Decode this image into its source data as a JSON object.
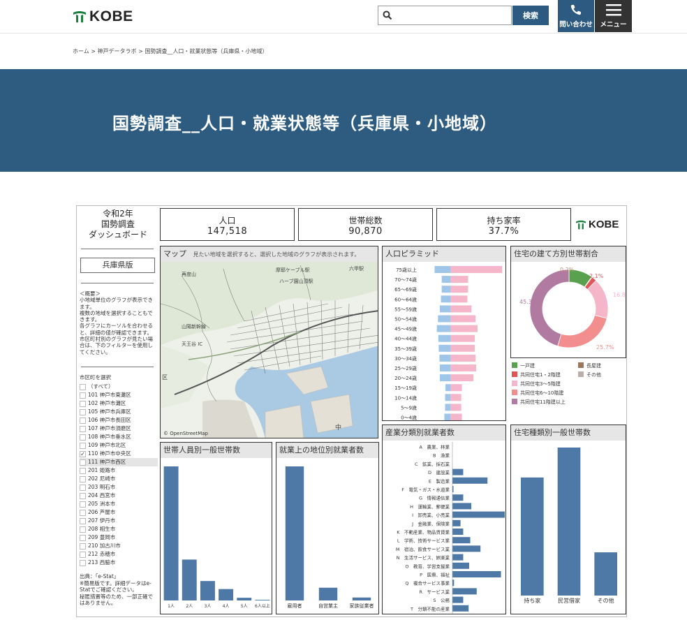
{
  "header": {
    "logo_text": "KOBE",
    "search_placeholder": "",
    "search_button": "検索",
    "contact_label": "問い合わせ",
    "menu_label": "メニュー"
  },
  "breadcrumb": "ホーム > 神戸データラボ > 国勢調査__人口・就業状態等（兵庫県・小地域）",
  "page_title": "国勢調査__人口・就業状態等（兵庫県・小地域）",
  "dashboard": {
    "side_title_lines": [
      "令和2年",
      "国勢調査",
      "ダッシュボード"
    ],
    "prefecture_button": "兵庫県版",
    "summary_text": "＜概要＞\n小地域単位のグラフが表示できます。\n複数の地域を選択することもできます。\n各グラフにカーソルを合わせると、詳細の値が確認できます。\n市区町村別のグラフが見たい場合は、下のフィルターを使用してください。",
    "filter_title": "市区町を選択",
    "filter_items": [
      {
        "label": "（すべて）",
        "checked": false
      },
      {
        "label": "101 神戸市東灘区",
        "checked": false
      },
      {
        "label": "102 神戸市灘区",
        "checked": false
      },
      {
        "label": "105 神戸市兵庫区",
        "checked": false
      },
      {
        "label": "106 神戸市長田区",
        "checked": false
      },
      {
        "label": "107 神戸市須磨区",
        "checked": false
      },
      {
        "label": "108 神戸市垂水区",
        "checked": false
      },
      {
        "label": "109 神戸市北区",
        "checked": false
      },
      {
        "label": "110 神戸市中央区",
        "checked": true
      },
      {
        "label": "111 神戸市西区",
        "checked": false,
        "highlight": true
      },
      {
        "label": "201 姫路市",
        "checked": false
      },
      {
        "label": "202 尼崎市",
        "checked": false
      },
      {
        "label": "203 明石市",
        "checked": false
      },
      {
        "label": "204 西宮市",
        "checked": false
      },
      {
        "label": "205 洲本市",
        "checked": false
      },
      {
        "label": "206 芦屋市",
        "checked": false
      },
      {
        "label": "207 伊丹市",
        "checked": false
      },
      {
        "label": "208 相生市",
        "checked": false
      },
      {
        "label": "209 豊岡市",
        "checked": false
      },
      {
        "label": "210 加古川市",
        "checked": false
      },
      {
        "label": "212 赤穂市",
        "checked": false
      },
      {
        "label": "213 西脇市",
        "checked": false
      }
    ],
    "source_text": "出典：「e-Stat」\n※簡易版です。詳細データはe-Statでご確認ください。\n秘匿措置等のため、一部正確ではありません。",
    "kpis": [
      {
        "label": "人口",
        "value": "147,518"
      },
      {
        "label": "世帯総数",
        "value": "90,870"
      },
      {
        "label": "持ち家率",
        "value": "37.7%"
      }
    ],
    "kobe_logo": "KOBE",
    "map": {
      "title": "マップ",
      "note": "見たい地域を選択すると、選択した地域のグラフが表示されます。",
      "attribution": "© OpenStreetMap",
      "labels": [
        "摩耶ケーブル駅",
        "六甲駅",
        "ハーブ園山頂駅",
        "再度山",
        "山陽新幹線",
        "天王谷 IC",
        "区",
        "中"
      ]
    },
    "colors": {
      "bar": "#4e79a7",
      "male": "#9fc5e8",
      "female": "#f4b6c8",
      "header_blue": "#2d5c80"
    }
  },
  "chart_data": [
    {
      "type": "bar",
      "title": "人口ピラミッド",
      "orientation": "horizontal",
      "categories": [
        "75歳以上",
        "70～74歳",
        "65～69歳",
        "60～64歳",
        "55～59歳",
        "50～54歳",
        "45～49歳",
        "40～44歳",
        "35～39歳",
        "30～34歳",
        "25～29歳",
        "20～24歳",
        "15～19歳",
        "10～14歳",
        "5～9歳",
        "0～4歳"
      ],
      "series": [
        {
          "name": "男",
          "values": [
            42,
            23,
            23,
            25,
            28,
            33,
            36,
            32,
            31,
            29,
            28,
            28,
            13,
            14,
            14,
            16
          ]
        },
        {
          "name": "女",
          "values": [
            76,
            26,
            26,
            25,
            31,
            37,
            40,
            36,
            36,
            37,
            38,
            34,
            17,
            16,
            16,
            17
          ]
        }
      ]
    },
    {
      "type": "pie",
      "title": "住宅の建て方別世帯割合",
      "categories": [
        "一戸建",
        "長屋建",
        "共同住宅1・2階建",
        "その他",
        "共同住宅3～5階建",
        "共同住宅6～10階建",
        "共同住宅11階建以上"
      ],
      "values": [
        9.9,
        0.2,
        2.1,
        0.0,
        16.8,
        25.7,
        45.3
      ],
      "labels": [
        "",
        "0.2%",
        "2.1%",
        "",
        "16.8%",
        "25.7%",
        "45.3%"
      ],
      "colors": [
        "#59a14f",
        "#9c755f",
        "#e15759",
        "#bab0ac",
        "#f6b6c9",
        "#f28e8e",
        "#b07aa1"
      ]
    },
    {
      "type": "bar",
      "title": "世帯人員別一般世帯数",
      "categories": [
        "1人",
        "2人",
        "3人",
        "4人",
        "5人",
        "6人以上"
      ],
      "values": [
        100,
        30.5,
        14.5,
        8.5,
        2,
        0.5
      ]
    },
    {
      "type": "bar",
      "title": "就業上の地位別就業者数",
      "categories": [
        "雇用者",
        "自営業主",
        "家族従業者"
      ],
      "values": [
        100,
        9.5,
        2.2
      ]
    },
    {
      "type": "bar",
      "title": "産業分類別就業者数",
      "orientation": "horizontal",
      "categories": [
        "A　農業、林業",
        "B　漁業",
        "C　鉱業、採石業",
        "D　建設業",
        "E　製造業",
        "F　電気・ガス・水道業",
        "G　情報通信業",
        "H　運輸業、郵便業",
        "I　卸売業、小売業",
        "J　金融業、保険業",
        "K　不動産業、物品賃貸業",
        "L　学術、技術サービス業",
        "M　宿泊、飲食サービス業",
        "N　生活サービス、娯楽業",
        "O　教育、学習支援業",
        "P　医療、福祉",
        "Q　複合サービス事業",
        "R　サービス業",
        "S　公務",
        "T　分類不能の産業"
      ],
      "values": [
        0,
        0,
        0,
        2,
        6.5,
        0.2,
        2,
        3.5,
        9.7,
        1.5,
        2,
        3.3,
        5.2,
        2,
        3.1,
        9,
        0.3,
        4.5,
        2,
        3
      ]
    },
    {
      "type": "bar",
      "title": "住宅種類別一般世帯数",
      "categories": [
        "持ち家",
        "民営借家",
        "その他"
      ],
      "values": [
        71,
        89,
        26
      ]
    }
  ]
}
